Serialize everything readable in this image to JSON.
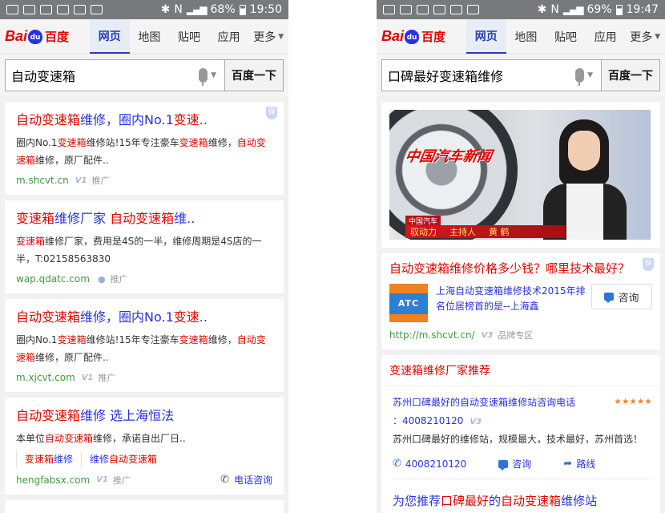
{
  "left": {
    "status": {
      "battery": "68%",
      "time": "19:50"
    },
    "nav": {
      "logo_bai": "Bai",
      "logo_du": "du",
      "logo_cn": "百度",
      "tabs": [
        "网页",
        "地图",
        "贴吧",
        "应用",
        "更多"
      ]
    },
    "search": {
      "query": "自动变速箱",
      "button": "百度一下"
    },
    "results": [
      {
        "title_hl": "自动变速箱",
        "title_rest": "维修，圈内No.1",
        "title_hl2": "变速",
        "title_end": "..",
        "desc": [
          "圈内No.1",
          "变速箱",
          "维修站!15年专注豪车",
          "变速箱",
          "维修，",
          "自动变速箱",
          "维修，原厂配件.."
        ],
        "url": "m.shcvt.cn",
        "promo": "推广"
      },
      {
        "title_hl": "变速箱",
        "title_rest": "维修厂家 ",
        "title_hl2": "自动变速箱",
        "title_end": "维..",
        "desc_a": "变速箱",
        "desc_b": "维修厂家，费用是4S的一半，维修周期是4S店的一半，T:02158563830",
        "url": "wap.qdatc.com",
        "promo": "推广"
      },
      {
        "title_hl": "自动变速箱",
        "title_rest": "维修，圈内No.1",
        "title_hl2": "变速",
        "title_end": "..",
        "desc": [
          "圈内No.1",
          "变速箱",
          "维修站!15年专注豪车",
          "变速箱",
          "维修，",
          "自动变速箱",
          "维修，原厂配件.."
        ],
        "url": "m.xjcvt.com",
        "promo": "推广"
      },
      {
        "title_hl": "自动变速箱",
        "title_rest": "维修 选上海恒法",
        "desc_a": "本单位",
        "desc_hl": "自动变速箱",
        "desc_b": "维修，承诺自出厂日..",
        "sub1_hl": "变速箱",
        "sub1": "维修",
        "sub2": "维修",
        "sub2_hl": "自动变速箱",
        "url": "hengfabsx.com",
        "promo": "推广",
        "call": "电话咨询"
      }
    ]
  },
  "right": {
    "status": {
      "battery": "69%",
      "time": "19:47"
    },
    "nav": {
      "logo_bai": "Bai",
      "logo_du": "du",
      "logo_cn": "百度",
      "tabs": [
        "网页",
        "地图",
        "贴吧",
        "应用",
        "更多"
      ]
    },
    "search": {
      "query": "口碑最好变速箱维修",
      "button": "百度一下"
    },
    "video": {
      "show_logo": "中国汽车新闻",
      "lt_top": "中国汽车",
      "lt_a": "驭动力",
      "lt_b": "主持人",
      "lt_c": "黄  鹤"
    },
    "ad": {
      "title_hl": "自动变速箱",
      "title_rest": "维修价格多少钱？哪里技术最好？",
      "logo": "ATC",
      "desc_a": "上海",
      "desc_hl": "自动变速箱",
      "desc_b": "维修技术2015年排名位居榜首的是--上海鑫",
      "consult": "咨询",
      "url": "http://m.shcvt.cn/",
      "zone": "品牌专区"
    },
    "rec": {
      "head": "变速箱维修厂家推荐",
      "title_a": "苏州",
      "title_hl": "口碑最好",
      "title_b": "的",
      "title_hl2": "自动变速箱",
      "title_c": "维修站咨询电话",
      "stars": "★★★★★",
      "phone": "：4008210120",
      "desc": "苏州口碑最好的维修站，规模最大，技术最好，苏州首选！",
      "action_call": "4008210120",
      "action_consult": "咨询",
      "action_route": "路线",
      "next_a": "为您推荐",
      "next_hl": "口碑最好",
      "next_b": "的",
      "next_hl2": "自动变速箱",
      "next_c": "维修站"
    }
  }
}
